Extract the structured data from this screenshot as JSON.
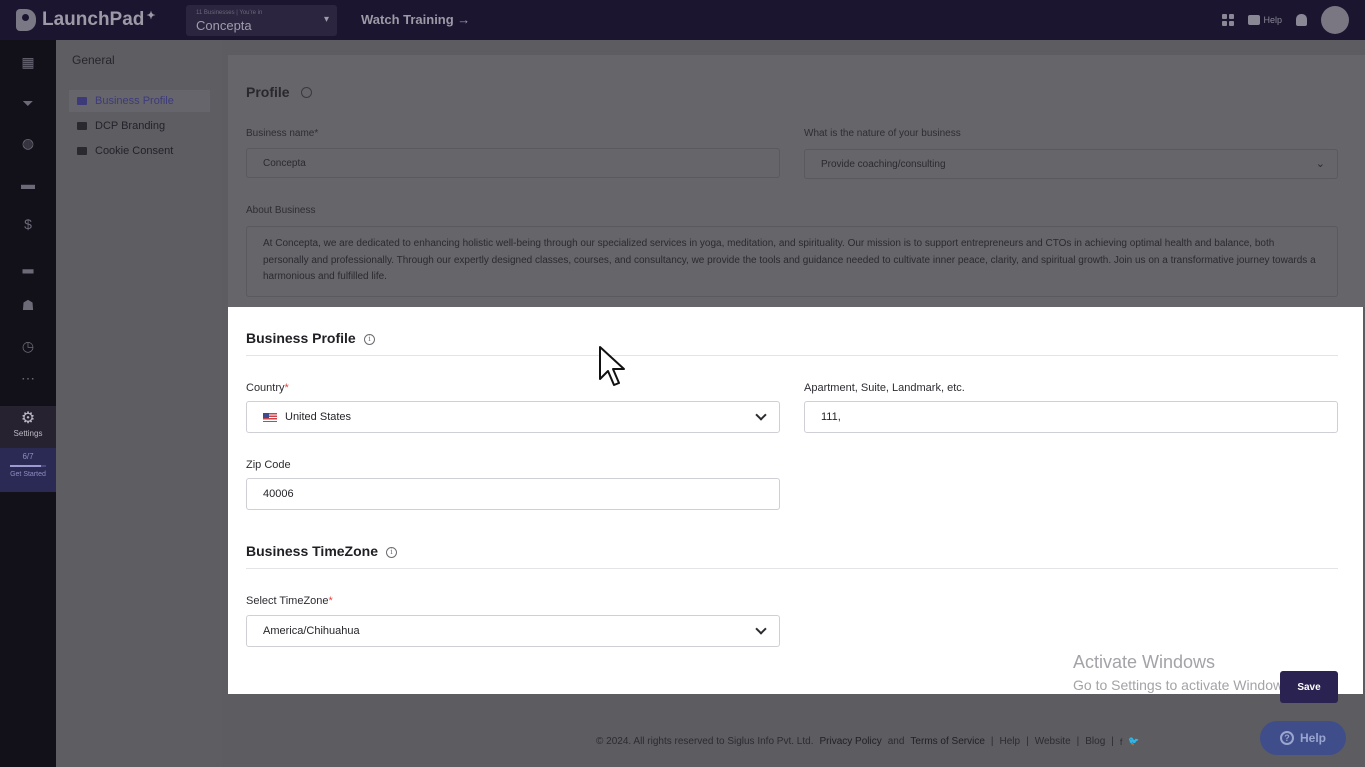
{
  "app": {
    "name": "LaunchPad",
    "accent": "#2a2250"
  },
  "topbar": {
    "business_caption": "11 Businesses | You're in",
    "business_name": "Concepta",
    "watch_training": "Watch Training →",
    "help_label": "Help"
  },
  "rail": {
    "icons": [
      "dashboard-icon",
      "funnel-icon",
      "globe-icon",
      "video-icon",
      "dollar-icon",
      "chart-icon",
      "community-icon",
      "clock-icon",
      "more-icon"
    ],
    "settings_label": "Settings",
    "progress_text": "6/7",
    "progress_fraction": 0.857,
    "get_started": "Get Started"
  },
  "subnav": {
    "heading": "General",
    "items": [
      {
        "label": "Business Profile",
        "icon": "card-icon"
      },
      {
        "label": "DCP Branding",
        "icon": "flag-icon"
      },
      {
        "label": "Cookie Consent",
        "icon": "cookie-icon"
      }
    ]
  },
  "profile": {
    "title": "Profile",
    "business_name_label": "Business name",
    "business_name_value": "Concepta",
    "nature_label": "What is the nature of your business",
    "nature_value": "Provide coaching/consulting",
    "about_label": "About Business",
    "about_value": "At Concepta, we are dedicated to enhancing holistic well-being through our specialized services in yoga, meditation, and spirituality. Our mission is to support entrepreneurs and CTOs in achieving optimal health and balance, both personally and professionally. Through our expertly designed classes, courses, and consultancy, we provide the tools and guidance needed to cultivate inner peace, clarity, and spiritual growth. Join us on a transformative journey towards a harmonious and fulfilled life."
  },
  "business_profile": {
    "title": "Business Profile",
    "country_label": "Country",
    "country_value": "United States",
    "apartment_label": "Apartment, Suite, Landmark, etc.",
    "apartment_value": "111,",
    "zip_label": "Zip Code",
    "zip_value": "40006"
  },
  "timezone": {
    "title": "Business TimeZone",
    "select_label": "Select TimeZone",
    "select_value": "America/Chihuahua"
  },
  "actions": {
    "save_label": "Save"
  },
  "watermark": {
    "line1": "Activate Windows",
    "line2": "Go to Settings to activate Windows."
  },
  "footer": {
    "copyright": "© 2024. All rights reserved to Siglus Info Pvt. Ltd.",
    "privacy": "Privacy Policy",
    "and": "and",
    "terms": "Terms of Service",
    "links": [
      "Help",
      "Website",
      "Blog"
    ],
    "sep": "|"
  },
  "help_button": {
    "label": "Help"
  }
}
